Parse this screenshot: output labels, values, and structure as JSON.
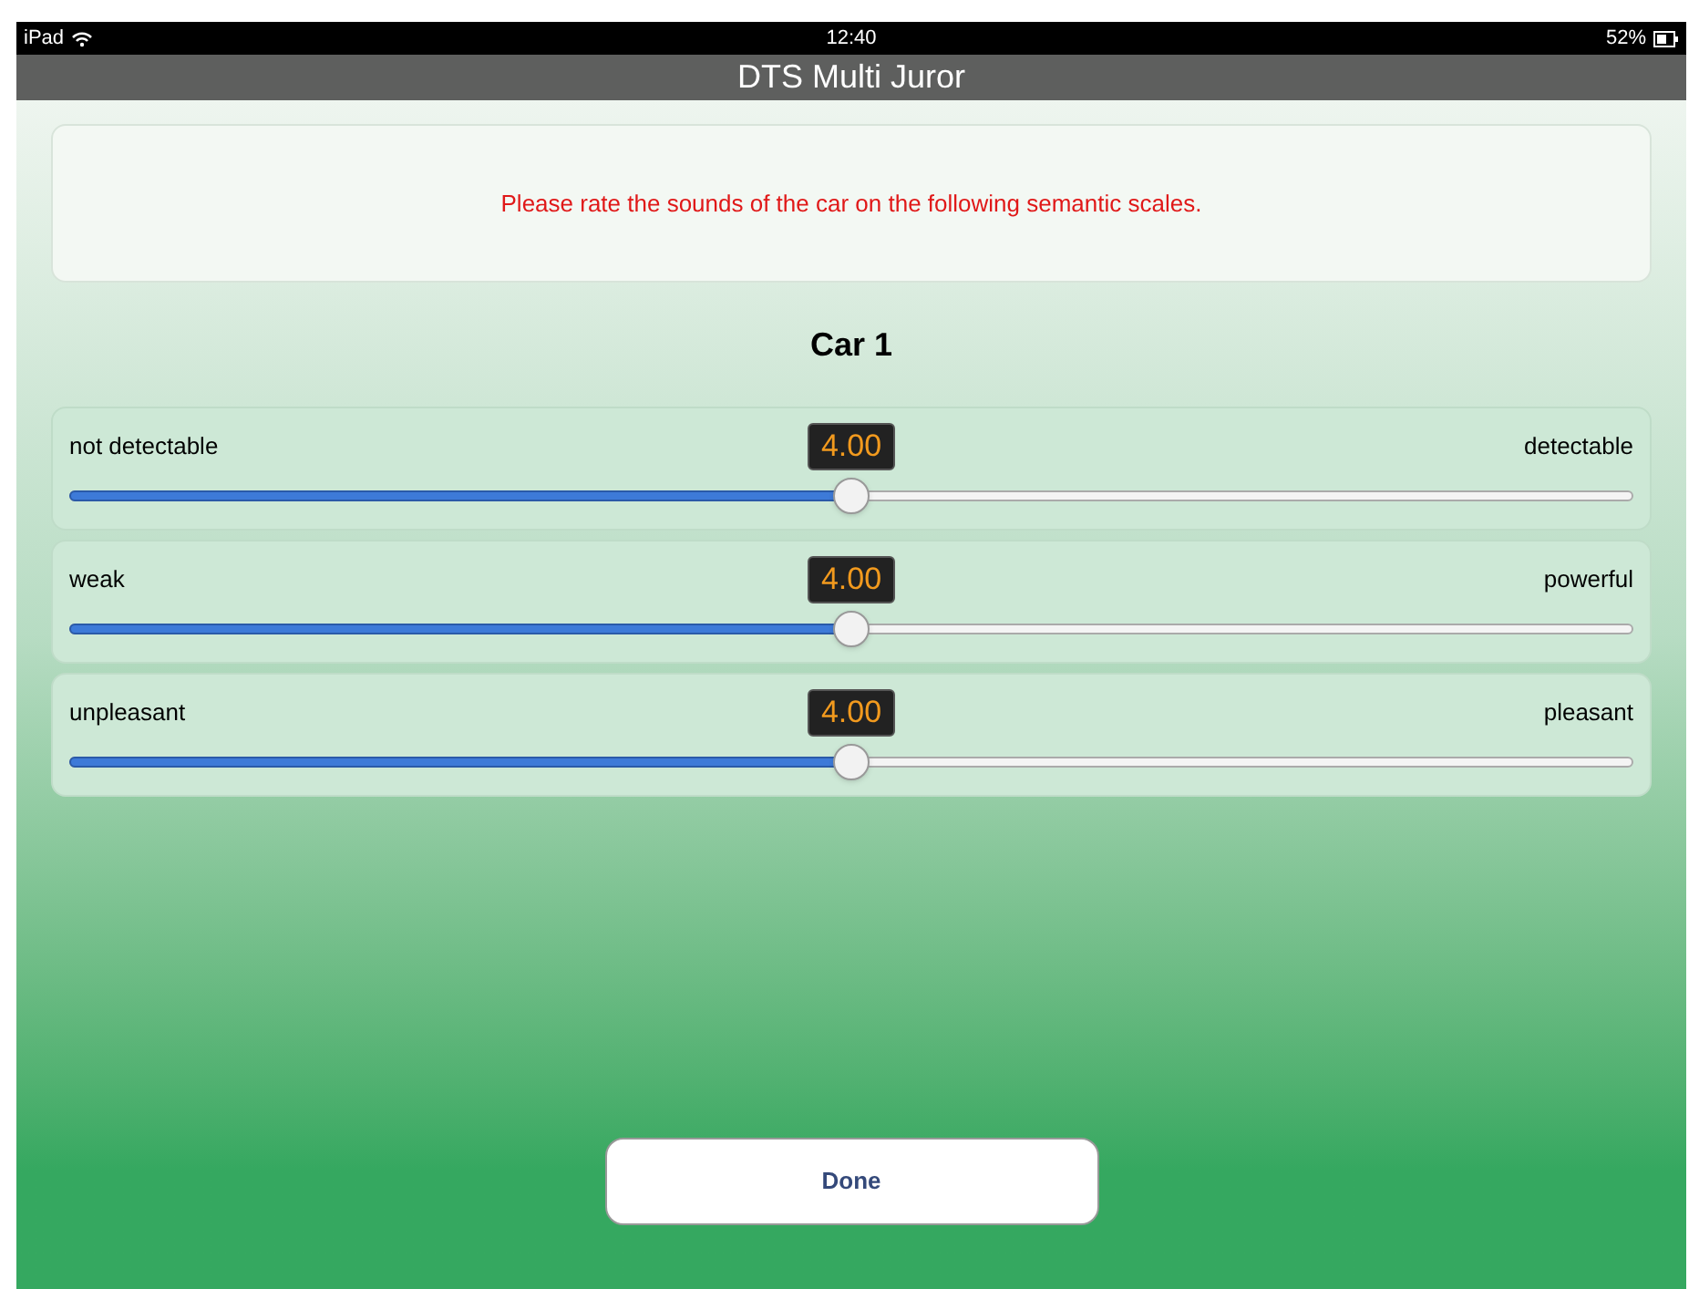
{
  "status_bar": {
    "device": "iPad",
    "time": "12:40",
    "battery": "52%"
  },
  "window": {
    "title": "DTS Multi Juror"
  },
  "instruction": "Please rate the sounds of the car on the following semantic scales.",
  "heading": "Car 1",
  "scales": [
    {
      "left": "not detectable",
      "right": "detectable",
      "reading": "4.00",
      "level": 0.5
    },
    {
      "left": "weak",
      "right": "powerful",
      "reading": "4.00",
      "level": 0.5
    },
    {
      "left": "unpleasant",
      "right": "pleasant",
      "reading": "4.00",
      "level": 0.5
    }
  ],
  "buttons": [
    "Done"
  ]
}
